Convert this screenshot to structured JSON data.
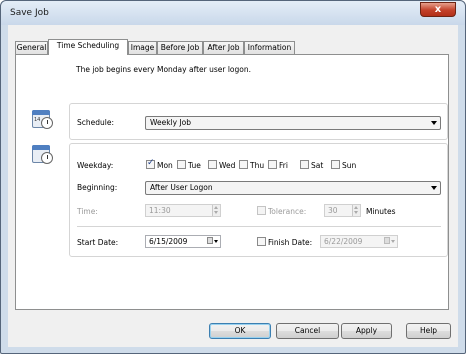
{
  "window": {
    "title": "Save Job",
    "close_glyph": "x"
  },
  "tabs": [
    "General",
    "Time Scheduling",
    "Image",
    "Before Job",
    "After Job",
    "Information"
  ],
  "active_tab": "Time Scheduling",
  "description": "The job begins every Monday after user logon.",
  "schedule": {
    "label": "Schedule:",
    "value": "Weekly Job",
    "icon": "calendar-clock-icon"
  },
  "weekly": {
    "icon": "calendar-clock-icon",
    "weekday_label": "Weekday:",
    "days": [
      {
        "label": "Mon",
        "checked": true
      },
      {
        "label": "Tue",
        "checked": false
      },
      {
        "label": "Wed",
        "checked": false
      },
      {
        "label": "Thu",
        "checked": false
      },
      {
        "label": "Fri",
        "checked": false
      },
      {
        "label": "Sat",
        "checked": false
      },
      {
        "label": "Sun",
        "checked": false
      }
    ],
    "beginning_label": "Beginning:",
    "beginning_value": "After User Logon",
    "time_label": "Time:",
    "time_value": "11:30",
    "tolerance_label": "Tolerance:",
    "tolerance_value": "30",
    "tolerance_unit": "Minutes",
    "start_date_label": "Start Date:",
    "start_date_value": "6/15/2009",
    "finish_date_label": "Finish Date:",
    "finish_date_value": "6/22/2009"
  },
  "buttons": {
    "ok": "OK",
    "cancel": "Cancel",
    "apply": "Apply",
    "help": "Help"
  },
  "colors": {
    "title_bar": "#c9d8ea",
    "close_button": "#c3412a",
    "default_button_border": "#3c7fb1"
  }
}
